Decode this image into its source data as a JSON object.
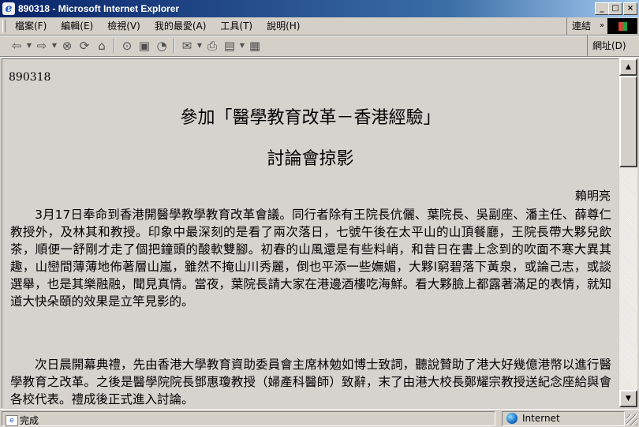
{
  "window": {
    "title": "890318 - Microsoft Internet Explorer",
    "minimize": "_",
    "maximize": "□",
    "close": "×"
  },
  "menu": {
    "items": [
      "檔案(F)",
      "編輯(E)",
      "檢視(V)",
      "我的最愛(A)",
      "工具(T)",
      "說明(H)"
    ],
    "links_label": "連結",
    "links_chevron": "»"
  },
  "toolbar": {
    "address_label": "網址(D)"
  },
  "document": {
    "id": "890318",
    "title_line1": "參加「醫學教育改革－香港經驗」",
    "title_line2": "討論會掠影",
    "author": "賴明亮",
    "paragraphs": [
      "　　3月17日奉命到香港開醫學教學教育改革會議。同行者除有王院長伉儷、葉院長、吳副座、潘主任、薛尊仁教授外，及林其和教授。印象中最深刻的是看了兩次落日，七號午後在太平山的山頂餐廳，王院長帶大夥兒飲茶，順便一舒剛才走了個把鐘頭的酸軟雙腳。初春的山風還是有些料峭，和昔日在書上念到的吹面不寒大異其趣，山巒間薄薄地佈著層山嵐，雖然不掩山川秀麗，倒也平添一些嫵媚，大夥l窮碧落下黃泉，或論己志，或談選舉，也是其樂融融，聞見真情。當夜，葉院長請大家在港邊酒樓吃海鮮。看大夥臉上都露著滿足的表情，就知道大快朵頤的效果是立竿見影的。",
      "　　次日晨開幕典禮，先由香港大學教育資助委員會主席林勉如博士致詞，聽說贊助了港大好幾億港幣以進行醫學教育之改革。之後是醫學院院長鄧惠瓊教授（婦產科醫師）致辭，末了由港大校長鄭耀宗教授送紀念座給與會各校代表。禮成後正式進入討論。"
    ]
  },
  "status": {
    "text": "完成",
    "zone": "Internet"
  }
}
